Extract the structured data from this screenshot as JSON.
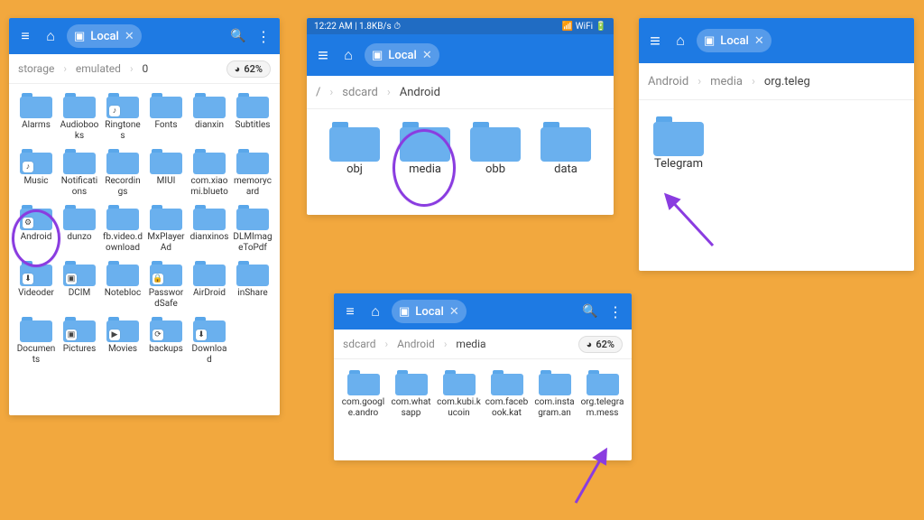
{
  "panels": {
    "p1": {
      "pill_label": "Local",
      "breadcrumbs": [
        "storage",
        "emulated",
        "0"
      ],
      "storage_pct": "62%",
      "items": [
        {
          "label": "Alarms"
        },
        {
          "label": "Audiobooks"
        },
        {
          "label": "Ringtones",
          "badge": "♪"
        },
        {
          "label": "Fonts"
        },
        {
          "label": "dianxin"
        },
        {
          "label": "Subtitles"
        },
        {
          "label": "Music",
          "badge": "♪"
        },
        {
          "label": "Notifications"
        },
        {
          "label": "Recordings"
        },
        {
          "label": "MIUI"
        },
        {
          "label": "com.xiaomi.blueto"
        },
        {
          "label": "memorycard"
        },
        {
          "label": "Android",
          "badge": "⚙"
        },
        {
          "label": "dunzo"
        },
        {
          "label": "fb.video.download"
        },
        {
          "label": "MxPlayerAd"
        },
        {
          "label": "dianxinos"
        },
        {
          "label": "DLMImageToPdf"
        },
        {
          "label": "Videoder",
          "badge": "⬇"
        },
        {
          "label": "DCIM",
          "badge": "▣"
        },
        {
          "label": "Notebloc"
        },
        {
          "label": "PasswordSafe",
          "badge": "🔒"
        },
        {
          "label": "AirDroid"
        },
        {
          "label": "inShare"
        },
        {
          "label": "Documents"
        },
        {
          "label": "Pictures",
          "badge": "▣"
        },
        {
          "label": "Movies",
          "badge": "▶"
        },
        {
          "label": "backups",
          "badge": "⟳"
        },
        {
          "label": "Download",
          "badge": "⬇"
        }
      ]
    },
    "p2": {
      "status_left": "12:22 AM | 1.8KB/s ⏱",
      "status_right": "📶 WiFi 🔋",
      "pill_label": "Local",
      "breadcrumbs": [
        "/",
        "sdcard",
        "Android"
      ],
      "items": [
        {
          "label": "obj"
        },
        {
          "label": "media"
        },
        {
          "label": "obb"
        },
        {
          "label": "data"
        }
      ]
    },
    "p3": {
      "pill_label": "Local",
      "breadcrumbs": [
        "Android",
        "media",
        "org.teleg"
      ],
      "items": [
        {
          "label": "Telegram"
        }
      ]
    },
    "p4": {
      "pill_label": "Local",
      "breadcrumbs": [
        "sdcard",
        "Android",
        "media"
      ],
      "storage_pct": "62%",
      "items": [
        {
          "label": "com.google.andro"
        },
        {
          "label": "com.whatsapp"
        },
        {
          "label": "com.kubi.kucoin"
        },
        {
          "label": "com.facebook.kat"
        },
        {
          "label": "com.instagram.an"
        },
        {
          "label": "org.telegram.mess"
        }
      ]
    }
  },
  "icons": {
    "hamburger": "≡",
    "home": "⌂",
    "search": "🔍",
    "dots": "⋮",
    "close": "✕",
    "pill": "▣",
    "sep": "›",
    "pie": "◕"
  }
}
